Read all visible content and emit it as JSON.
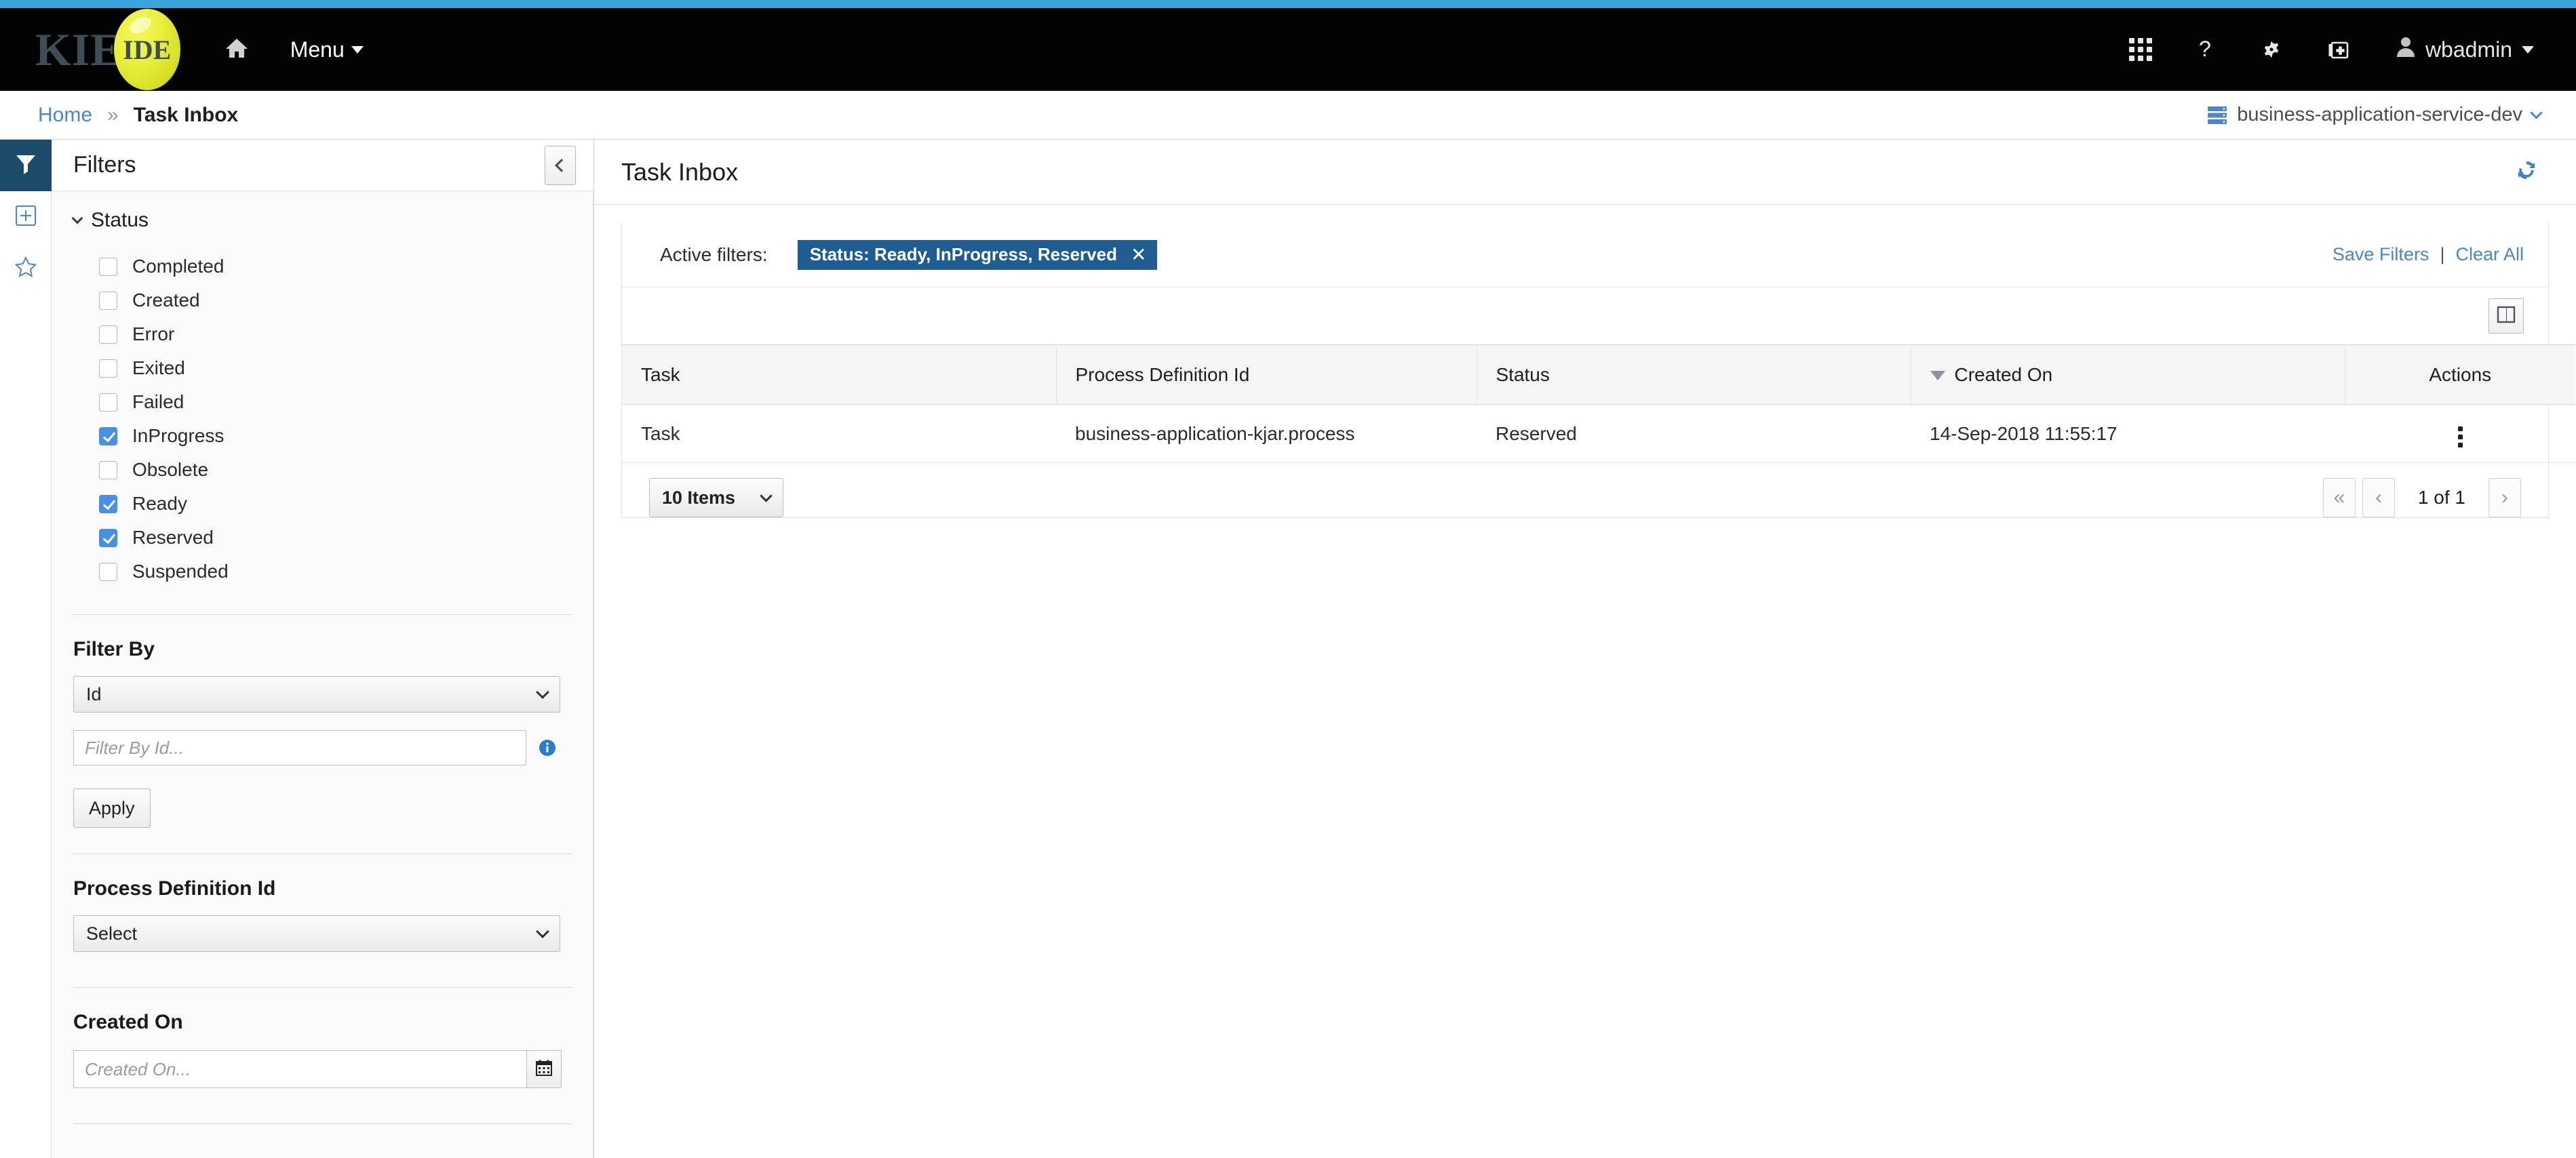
{
  "masthead": {
    "brand_primary": "KIE",
    "brand_badge": "IDE",
    "home_icon": "home-icon",
    "menu_label": "Menu",
    "icons": [
      "apps-grid-icon",
      "help-question-icon",
      "gear-icon",
      "first-aid-kit-icon"
    ],
    "user_label": "wbadmin",
    "accent_color": "#39a5dc",
    "background_color": "#030303"
  },
  "breadcrumb": {
    "home": "Home",
    "separator": "»",
    "current": "Task Inbox",
    "server": "business-application-service-dev",
    "link_color": "#4a87c4"
  },
  "rail": {
    "items": [
      {
        "name": "filter-icon",
        "active": true
      },
      {
        "name": "plus-square-icon",
        "active": false
      },
      {
        "name": "star-icon",
        "active": false
      }
    ]
  },
  "filters_panel": {
    "title": "Filters",
    "collapse_icon": "chevron-left-icon",
    "status_section": {
      "label": "Status",
      "expanded": true,
      "options": [
        {
          "label": "Completed",
          "checked": false
        },
        {
          "label": "Created",
          "checked": false
        },
        {
          "label": "Error",
          "checked": false
        },
        {
          "label": "Exited",
          "checked": false
        },
        {
          "label": "Failed",
          "checked": false
        },
        {
          "label": "InProgress",
          "checked": true
        },
        {
          "label": "Obsolete",
          "checked": false
        },
        {
          "label": "Ready",
          "checked": true
        },
        {
          "label": "Reserved",
          "checked": true
        },
        {
          "label": "Suspended",
          "checked": false
        }
      ],
      "checked_color": "#4a90e2"
    },
    "filter_by": {
      "label": "Filter By",
      "select_value": "Id",
      "input_placeholder": "Filter By Id...",
      "input_value": "",
      "info_icon": "info-circle-icon",
      "apply_label": "Apply"
    },
    "process_definition": {
      "label": "Process Definition Id",
      "select_value": "Select"
    },
    "created_on": {
      "label": "Created On",
      "input_placeholder": "Created On...",
      "input_value": "",
      "calendar_icon": "calendar-icon"
    }
  },
  "main": {
    "title": "Task Inbox",
    "refresh_icon": "refresh-icon",
    "active_filters_label": "Active filters:",
    "chips": [
      {
        "label": "Status: Ready, InProgress, Reserved",
        "remove_icon": "close-x-icon",
        "color": "#1f5c92"
      }
    ],
    "save_filters_label": "Save Filters",
    "links_separator": "|",
    "clear_all_label": "Clear All",
    "columns_button_icon": "column-chooser-icon",
    "table": {
      "columns": [
        "Task",
        "Process Definition Id",
        "Status",
        "Created On",
        "Actions"
      ],
      "sorted_column": "Created On",
      "sort_direction": "desc",
      "rows": [
        {
          "task": "Task",
          "process_definition_id": "business-application-kjar.process",
          "status": "Reserved",
          "created_on": "14-Sep-2018 11:55:17",
          "actions_icon": "kebab-menu-icon"
        }
      ]
    },
    "pagination": {
      "page_size_label": "10 Items",
      "first_label": "«",
      "prev_label": "‹",
      "page_text": "1 of 1",
      "next_label": "›"
    }
  }
}
